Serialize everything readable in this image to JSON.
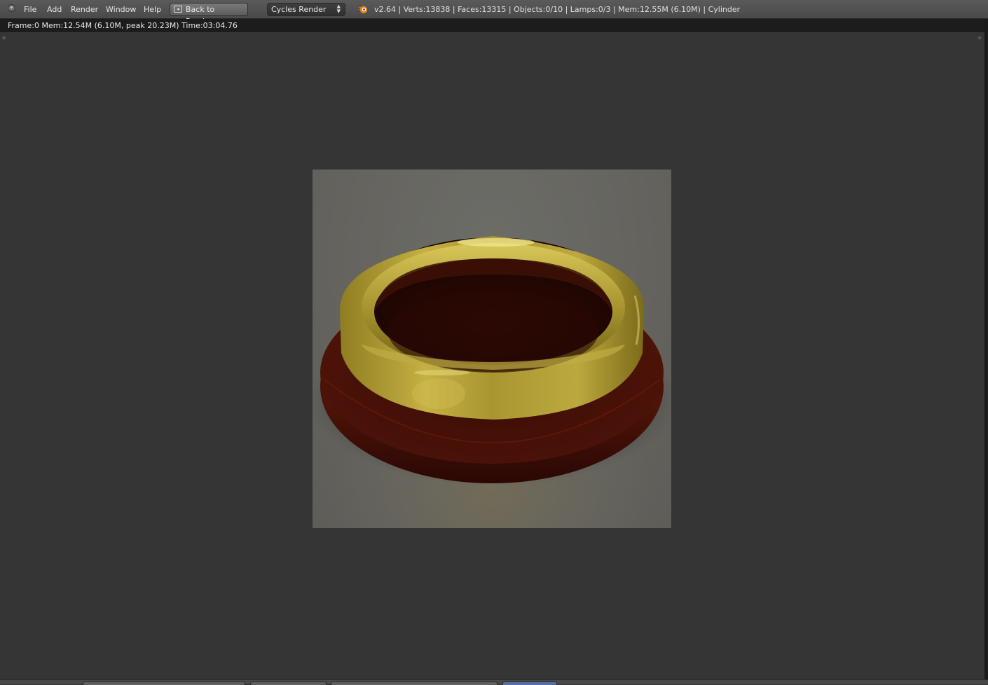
{
  "header": {
    "menus": [
      "File",
      "Add",
      "Render",
      "Window",
      "Help"
    ],
    "back_button_label": "Back to Previous",
    "render_engine": "Cycles Render",
    "stats": "v2.64 | Verts:13838 | Faces:13315 | Objects:0/10 | Lamps:0/3 | Mem:12.55M (6.10M) | Cylinder"
  },
  "render_info": {
    "text": "Frame:0 Mem:12.54M (6.10M, peak 20.23M) Time:03:04.76"
  },
  "colors": {
    "background": "#353535",
    "header": "#4f4f4f",
    "info_strip": "#1c1c1c",
    "ring_gold": "#b9a43a",
    "base_maroon": "#4a1208"
  },
  "icons": {
    "area_toggle": "circle-arrow-icon",
    "back_button": "screen-back-icon",
    "engine_select": "up-down-arrows-icon",
    "logo": "blender-logo-icon",
    "region_expand": "plus-icon"
  }
}
